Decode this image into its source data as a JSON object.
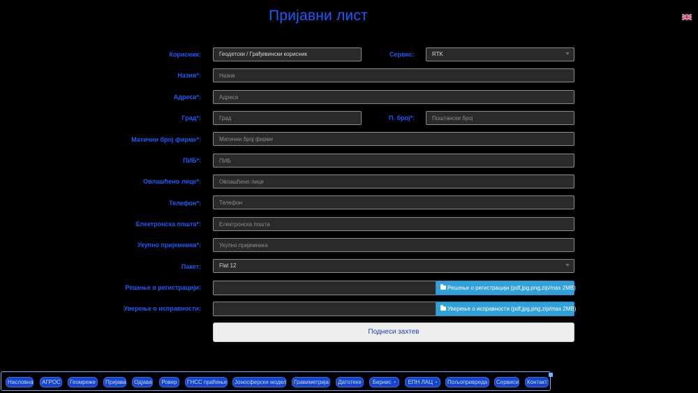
{
  "page": {
    "title": "Пријавни лист"
  },
  "language": {
    "flag": "uk-flag"
  },
  "form": {
    "korisnik": {
      "label": "Корисник:",
      "value": "Геодетски / Грађевински корисник"
    },
    "servis": {
      "label": "Сервис:",
      "value": "RTK"
    },
    "naziv": {
      "label": "Назив*:",
      "placeholder": "Назив"
    },
    "adresa": {
      "label": "Адреса*:",
      "placeholder": "Адреса"
    },
    "grad": {
      "label": "Град*:",
      "placeholder": "Град"
    },
    "pbroj": {
      "label": "П. број*:",
      "placeholder": "Поштански број"
    },
    "maticni": {
      "label": "Матични број фирме*:",
      "placeholder": "Матични број фирме"
    },
    "pib": {
      "label": "ПИБ*:",
      "placeholder": "ПИБ"
    },
    "ovlasceno": {
      "label": "Овлашћено лице*:",
      "placeholder": "Овлашћено лице"
    },
    "telefon": {
      "label": "Телефон*:",
      "placeholder": "Телефон"
    },
    "email": {
      "label": "Електронска пошта*:",
      "placeholder": "Електронска пошта"
    },
    "prijemnici": {
      "label": "Укупно пријемника*:",
      "placeholder": "Укупно пријемника"
    },
    "paket": {
      "label": "Пакет:",
      "value": "Flat 12"
    },
    "resenje": {
      "label": "Решење о регистрацији:",
      "button": "Решење о регистрацији (pdf,jpg,png,zip/max 2MB)"
    },
    "uverenje": {
      "label": "Уверење о исправности:",
      "button": "Уверење о исправности (pdf,jpg,png,zip/max 2MB)"
    },
    "submit": "Поднеси захтев"
  },
  "nav": [
    {
      "label": "Насловна"
    },
    {
      "label": "АГРОС"
    },
    {
      "label": "Геомреже"
    },
    {
      "label": "Пријава"
    },
    {
      "label": "Одјава"
    },
    {
      "label": "Ровер"
    },
    {
      "label": "ГНСС праћење"
    },
    {
      "label": "Јоносферски модел"
    },
    {
      "label": "Гравиметрија"
    },
    {
      "label": "Датотеке"
    },
    {
      "label": "Бернис",
      "suffix": "◔"
    },
    {
      "label": "ЕПН ЛАЦ",
      "suffix": "◔"
    },
    {
      "label": "Пољопривреда"
    },
    {
      "label": "Сервиси"
    },
    {
      "label": "Контакт"
    }
  ]
}
